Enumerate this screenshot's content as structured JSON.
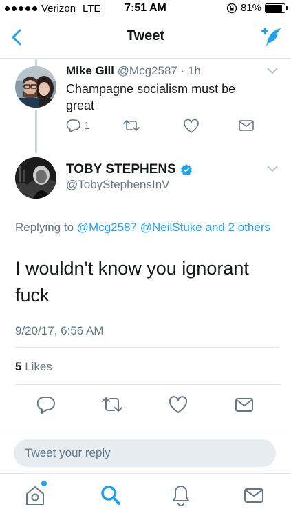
{
  "status_bar": {
    "carrier": "Verizon",
    "network": "LTE",
    "time": "7:51 AM",
    "battery_percent": "81%",
    "battery_level": 0.81,
    "signal_bars": 5
  },
  "nav": {
    "title": "Tweet",
    "back_icon": "chevron-left-icon",
    "compose_icon": "compose-tweet-icon"
  },
  "reply_tweet": {
    "name": "Mike Gill",
    "handle": "@Mcg2587",
    "time": "· 1h",
    "text": "Champagne socialism must be great",
    "reply_count": "1"
  },
  "main_tweet": {
    "name": "TOBY STEPHENS",
    "handle": "@TobyStephensInV",
    "replying_prefix": "Replying to",
    "replying_user1": "@Mcg2587",
    "replying_user2": "@NeilStuke",
    "replying_suffix": "and 2 others",
    "text": "I wouldn't know you ignorant fuck",
    "timestamp": "9/20/17, 6:56 AM",
    "likes_count": "5",
    "likes_label": "Likes"
  },
  "reply_box": {
    "placeholder": "Tweet your reply"
  },
  "colors": {
    "accent": "#1da1f2",
    "secondary_text": "#657786",
    "divider": "#e1e8ed"
  }
}
